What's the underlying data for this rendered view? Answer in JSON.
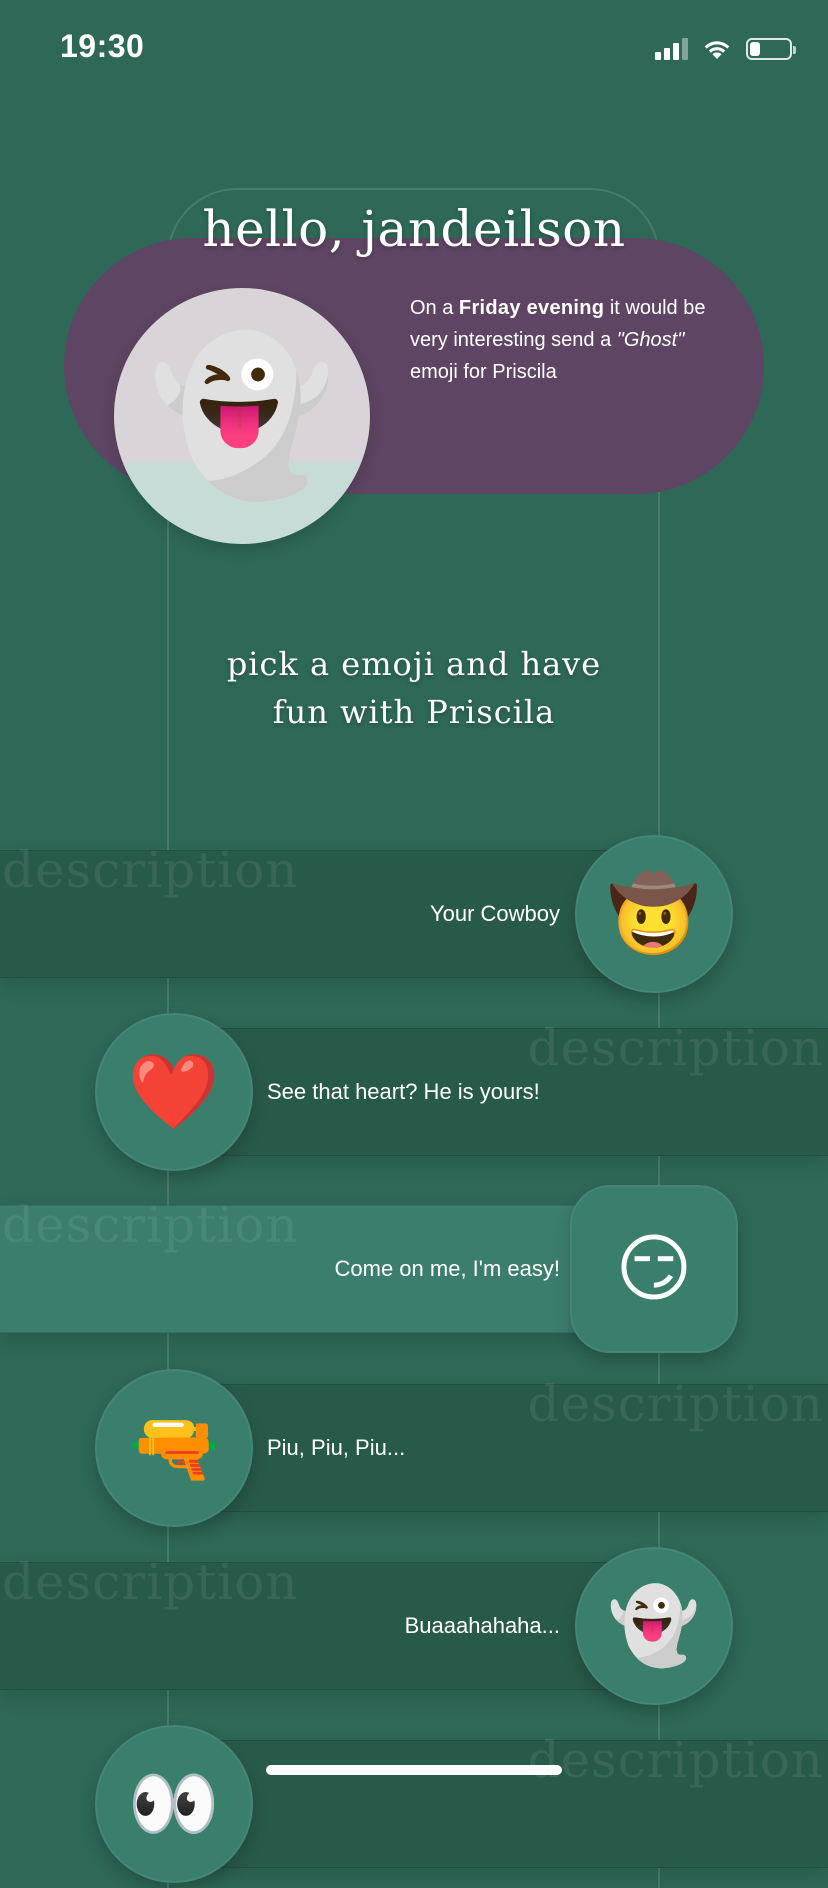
{
  "status_bar": {
    "time": "19:30",
    "signal_icon": "cellular-signal-icon",
    "wifi_icon": "wifi-icon",
    "battery_icon": "battery-icon",
    "battery_level": 0.25
  },
  "header": {
    "greeting": "hello, jandeilson"
  },
  "suggestion": {
    "emoji": "👻",
    "text_prefix": "On a ",
    "day": "Friday evening",
    "text_middle": " it would be very interesting send a ",
    "emoji_name": "\"Ghost\"",
    "text_suffix": " emoji for Priscila",
    "card_color": "#5e4563"
  },
  "pick_heading": {
    "line1": "pick a emoji and have",
    "line2": "fun with Priscila"
  },
  "emoji_list": [
    {
      "emoji": "🤠",
      "label": "Your Cowboy",
      "watermark": "description"
    },
    {
      "emoji": "❤️",
      "label": "See that heart? He is yours!",
      "watermark": "description"
    },
    {
      "emoji": "😏",
      "label": "Come on me, I'm easy!",
      "watermark": "description"
    },
    {
      "emoji": "🔫",
      "label": "Piu, Piu, Piu...",
      "watermark": "description"
    },
    {
      "emoji": "👻",
      "label": "Buaaahahaha...",
      "watermark": "description"
    },
    {
      "emoji": "👀",
      "label": "",
      "watermark": "description"
    }
  ],
  "colors": {
    "background": "#2e6857",
    "row_dark": "#285a4a",
    "row_light": "#3b7e6b",
    "emoji_circle": "#3a7f6c"
  }
}
